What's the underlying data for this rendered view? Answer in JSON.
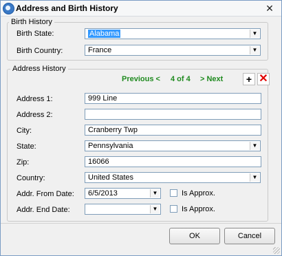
{
  "window": {
    "title": "Address and Birth History",
    "close_glyph": "✕",
    "icon": "app-icon"
  },
  "birth_history": {
    "legend": "Birth History",
    "birth_state_label": "Birth State:",
    "birth_state_value": "Alabama",
    "birth_country_label": "Birth Country:",
    "birth_country_value": "France"
  },
  "address_history": {
    "legend": "Address History",
    "nav": {
      "previous": "Previous <",
      "position": "4 of 4",
      "next": "> Next"
    },
    "add_glyph": "+",
    "delete_glyph": "✕",
    "address1_label": "Address 1:",
    "address1_value": "999 Line",
    "address2_label": "Address 2:",
    "address2_value": "",
    "city_label": "City:",
    "city_value": "Cranberry Twp",
    "state_label": "State:",
    "state_value": "Pennsylvania",
    "zip_label": "Zip:",
    "zip_value": "16066",
    "country_label": "Country:",
    "country_value": "United States",
    "from_date_label": "Addr. From Date:",
    "from_date_value": "6/5/2013",
    "end_date_label": "Addr. End Date:",
    "end_date_value": "",
    "is_approx_label": "Is Approx.",
    "is_approx_end_label": "Is Approx."
  },
  "buttons": {
    "ok": "OK",
    "cancel": "Cancel"
  },
  "colors": {
    "nav_green": "#1f8a1f",
    "delete_red": "#e00000",
    "selection_blue": "#3399ff"
  }
}
